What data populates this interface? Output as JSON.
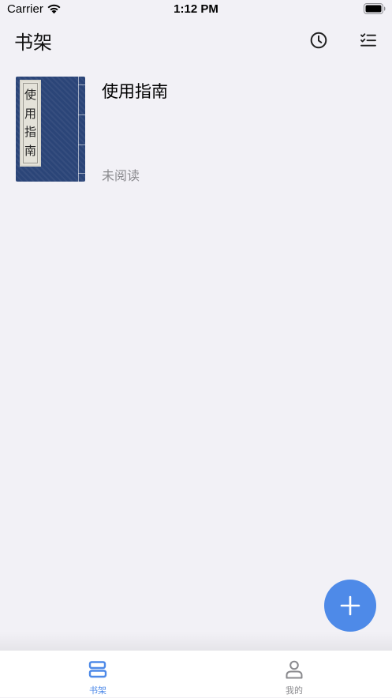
{
  "status_bar": {
    "carrier": "Carrier",
    "time": "1:12 PM",
    "wifi_icon": "wifi-icon",
    "battery_icon": "battery-icon"
  },
  "nav": {
    "title": "书架",
    "history_icon": "clock-icon",
    "manage_icon": "checklist-icon"
  },
  "books": [
    {
      "title": "使用指南",
      "status": "未阅读",
      "cover_chars": [
        "使",
        "用",
        "指",
        "南"
      ],
      "cover_color": "#2b4578"
    }
  ],
  "fab": {
    "icon": "plus-icon",
    "color": "#4e8ae8"
  },
  "tabs": [
    {
      "label": "书架",
      "icon": "bookshelf-icon",
      "active": true
    },
    {
      "label": "我的",
      "icon": "person-icon",
      "active": false
    }
  ],
  "colors": {
    "accent": "#4e8ae8",
    "background": "#f2f1f6",
    "inactive": "#8a8a8e"
  }
}
